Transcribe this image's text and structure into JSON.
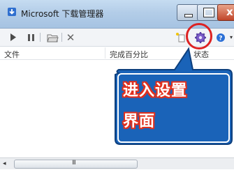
{
  "window": {
    "title": "Microsoft 下载管理器"
  },
  "title_buttons": {
    "close_glyph": "x"
  },
  "toolbar": {
    "icons": [
      "play-icon",
      "pause-icon",
      "open-folder-icon",
      "delete-icon",
      "new-download-icon",
      "settings-icon",
      "help-icon"
    ],
    "delete_glyph": "✕",
    "help_arrow": "▾"
  },
  "columns": {
    "file": "文件",
    "progress": "完成百分比",
    "status": "状态"
  },
  "scrollbar": {
    "left_arrow": "◂",
    "grip": "III"
  },
  "annotation": {
    "line1": "进入设置",
    "line2": "界面",
    "ring_color": "#dd2222",
    "bubble_color": "#1a63b8"
  }
}
